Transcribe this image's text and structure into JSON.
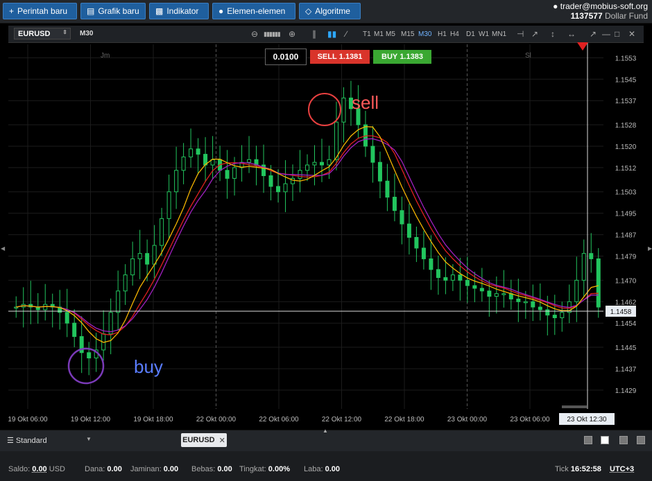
{
  "toolbar": {
    "new_order": "Perintah baru",
    "new_chart": "Grafik baru",
    "indicator": "Indikator",
    "elements": "Elemen-elemen",
    "algorithm": "Algoritme"
  },
  "account": {
    "email": "trader@mobius-soft.org",
    "number": "1137577",
    "fund": "Dollar Fund"
  },
  "chart": {
    "symbol": "EURUSD",
    "timeframe": "M30",
    "timeframes": [
      "T1",
      "M1",
      "M5",
      "M15",
      "M30",
      "H1",
      "H4",
      "D1",
      "W1",
      "MN1"
    ],
    "active_timeframe": "M30",
    "lot": "0.0100",
    "sell_label": "SELL",
    "sell_price": "1.1381",
    "buy_label": "BUY",
    "buy_price": "1.1383",
    "session_jm": "Jm",
    "session_sl": "Sl",
    "annotation_sell": "sell",
    "annotation_buy": "buy",
    "current_price": "1.1458",
    "cursor_time": "23 Okt 12:30",
    "colors": {
      "bull": "#22c55e",
      "bear": "#22c55e",
      "ma_fast": "#f5b400",
      "ma_slow": "#e02020",
      "ma_mid": "#a020c0",
      "sell_btn": "#d9342b",
      "buy_btn": "#3aa832"
    }
  },
  "chart_data": {
    "type": "candlestick",
    "y_ticks": [
      "1.1553",
      "1.1545",
      "1.1537",
      "1.1528",
      "1.1520",
      "1.1512",
      "1.1503",
      "1.1495",
      "1.1487",
      "1.1479",
      "1.1470",
      "1.1462",
      "1.1454",
      "1.1445",
      "1.1437",
      "1.1429"
    ],
    "ylim": [
      1.1422,
      1.1558
    ],
    "x_ticks": [
      "19 Okt 06:00",
      "19 Okt 12:00",
      "19 Okt 18:00",
      "22 Okt 00:00",
      "22 Okt 06:00",
      "22 Okt 12:00",
      "22 Okt 18:00",
      "23 Okt 00:00",
      "23 Okt 06:00"
    ],
    "close": [
      1.146,
      1.1461,
      1.146,
      1.1459,
      1.1461,
      1.146,
      1.1458,
      1.1454,
      1.1449,
      1.1443,
      1.1441,
      1.1444,
      1.145,
      1.1458,
      1.1466,
      1.1472,
      1.1478,
      1.148,
      1.1476,
      1.1483,
      1.1493,
      1.1503,
      1.1511,
      1.1516,
      1.1519,
      1.1517,
      1.1513,
      1.1515,
      1.1511,
      1.1508,
      1.1512,
      1.1514,
      1.1515,
      1.1513,
      1.1509,
      1.1505,
      1.1503,
      1.1506,
      1.1508,
      1.1511,
      1.1513,
      1.1514,
      1.1513,
      1.1515,
      1.1529,
      1.1538,
      1.1534,
      1.1528,
      1.152,
      1.1514,
      1.1507,
      1.1501,
      1.1496,
      1.1491,
      1.1486,
      1.1482,
      1.1478,
      1.1474,
      1.1471,
      1.147,
      1.1472,
      1.147,
      1.1468,
      1.1467,
      1.1466,
      1.1464,
      1.1465,
      1.1465,
      1.1463,
      1.1462,
      1.1462,
      1.146,
      1.1459,
      1.1457,
      1.1456,
      1.1458,
      1.1462,
      1.147,
      1.148,
      1.1478,
      1.146
    ]
  },
  "bottom": {
    "layout_label": "Standard",
    "tab_label": "EURUSD"
  },
  "status": {
    "saldo_label": "Saldo:",
    "saldo_value": "0.00",
    "saldo_ccy": "USD",
    "dana_label": "Dana:",
    "dana_value": "0.00",
    "jaminan_label": "Jaminan:",
    "jaminan_value": "0.00",
    "bebas_label": "Bebas:",
    "bebas_value": "0.00",
    "tingkat_label": "Tingkat:",
    "tingkat_value": "0.00%",
    "laba_label": "Laba:",
    "laba_value": "0.00",
    "tick_label": "Tick",
    "time": "16:52:58",
    "timezone": "UTC+3"
  }
}
